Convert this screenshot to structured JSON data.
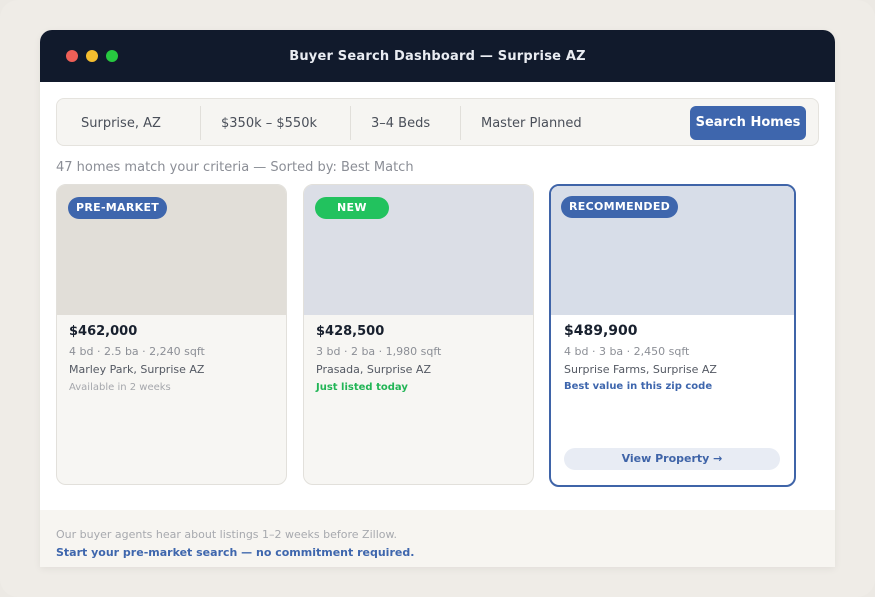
{
  "window": {
    "title": "Buyer Search Dashboard — Surprise AZ"
  },
  "search": {
    "location": "Surprise, AZ",
    "price": "$350k – $550k",
    "beds": "3–4 Beds",
    "community": "Master Planned",
    "button_label": "Search Homes"
  },
  "results": {
    "summary": "47 homes match your criteria — Sorted by: Best Match"
  },
  "cards": [
    {
      "badge": "PRE-MARKET",
      "badge_color": "#3e66ad",
      "photo_color": "#e1ded8",
      "price": "$462,000",
      "specs": "4 bd · 2.5 ba · 2,240 sqft",
      "location": "Marley Park, Surprise AZ",
      "note": "Available in 2 weeks",
      "note_color": "#a5a7ac"
    },
    {
      "badge": "NEW",
      "badge_color": "#22c25e",
      "photo_color": "#dbdee6",
      "price": "$428,500",
      "specs": "3 bd · 2 ba · 1,980 sqft",
      "location": "Prasada, Surprise AZ",
      "note": "Just listed today",
      "note_color": "#22b556"
    },
    {
      "badge": "RECOMMENDED",
      "badge_color": "#3e66ad",
      "photo_color": "#d7dde8",
      "price": "$489,900",
      "specs": "4 bd · 3 ba · 2,450 sqft",
      "location": "Surprise Farms, Surprise AZ",
      "note": "Best value in this zip code",
      "note_color": "#3e66ad",
      "action": "View Property →"
    }
  ],
  "footer": {
    "line1": "Our buyer agents hear about listings 1–2 weeks before Zillow.",
    "line2": "Start your pre-market search — no commitment required."
  }
}
